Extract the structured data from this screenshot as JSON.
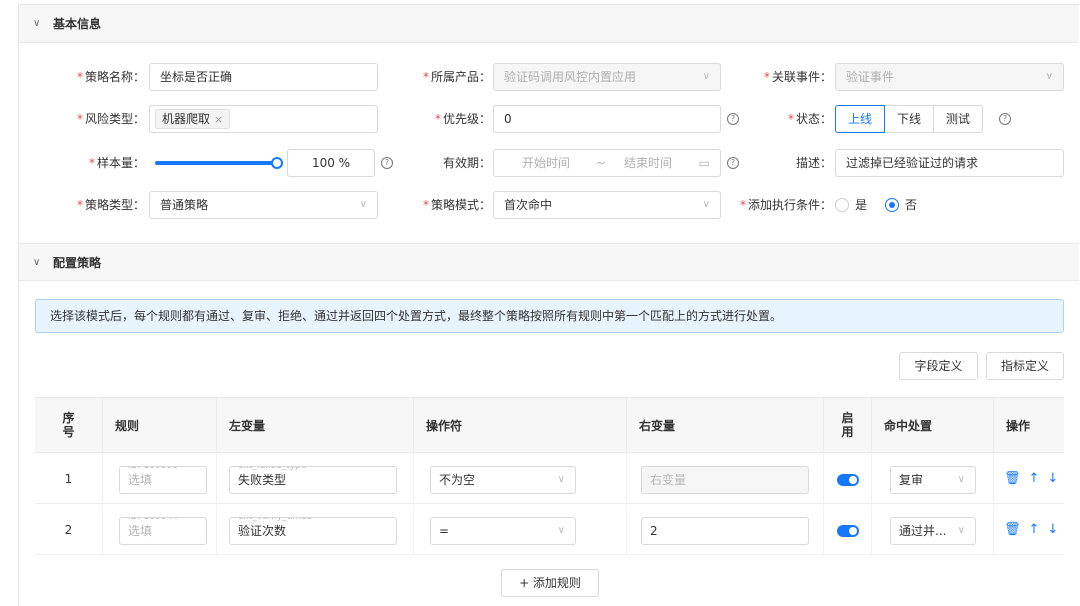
{
  "sections": {
    "basic": {
      "title": "基本信息"
    },
    "config": {
      "title": "配置策略"
    }
  },
  "basic_form": {
    "policy_name": {
      "label": "策略名称：",
      "value": "坐标是否正确"
    },
    "product": {
      "label": "所属产品：",
      "value": "验证码调用风控内置应用"
    },
    "event": {
      "label": "关联事件：",
      "value": "验证事件"
    },
    "risk_type": {
      "label": "风险类型：",
      "tag": "机器爬取"
    },
    "priority": {
      "label": "优先级：",
      "value": "0"
    },
    "status": {
      "label": "状态：",
      "options": [
        "上线",
        "下线",
        "测试"
      ],
      "selected": "上线"
    },
    "sample": {
      "label": "样本量：",
      "value": "100 %",
      "level_percent": 100
    },
    "validity": {
      "label": "有效期：",
      "start_placeholder": "开始时间",
      "separator": "~",
      "end_placeholder": "结束时间"
    },
    "description": {
      "label": "描述：",
      "value": "过滤掉已经验证过的请求"
    },
    "policy_type": {
      "label": "策略类型：",
      "value": "普通策略"
    },
    "policy_mode": {
      "label": "策略模式：",
      "value": "首次命中"
    },
    "add_condition": {
      "label": "添加执行条件：",
      "options": [
        "是",
        "否"
      ],
      "selected": "否"
    }
  },
  "alert": "选择该模式后，每个规则都有通过、复审、拒绝、通过并返回四个处置方式，最终整个策略按照所有规则中第一个匹配上的方式进行处置。",
  "buttons": {
    "field_def": "字段定义",
    "metric_def": "指标定义",
    "add_rule": "+ 添加规则"
  },
  "table": {
    "headers": {
      "index_1": "序",
      "index_2": "号",
      "rule": "规则",
      "left": "左变量",
      "op": "操作符",
      "right": "右变量",
      "enable_1": "启",
      "enable_2": "用",
      "hit": "命中处置",
      "action": "操作"
    },
    "rows": [
      {
        "index": "1",
        "rule_id": "ID: 100008",
        "rule_placeholder": "选填",
        "left_key": "ext_failed_type",
        "left_value": "失败类型",
        "op": "不为空",
        "right": "右变量",
        "right_disabled": true,
        "enabled": true,
        "hit": "复审"
      },
      {
        "index": "2",
        "rule_id": "ID: 100044",
        "rule_placeholder": "选填",
        "left_key": "ext_verify_times",
        "left_value": "验证次数",
        "op": "=",
        "right": "2",
        "right_disabled": false,
        "enabled": true,
        "hit": "通过并..."
      }
    ],
    "op_icons": {
      "delete": "🗑",
      "up": "↑",
      "down": "↓"
    }
  },
  "colors": {
    "primary": "#1677ff",
    "required": "#e84a4a",
    "alert_bg": "#e8f4fd"
  }
}
